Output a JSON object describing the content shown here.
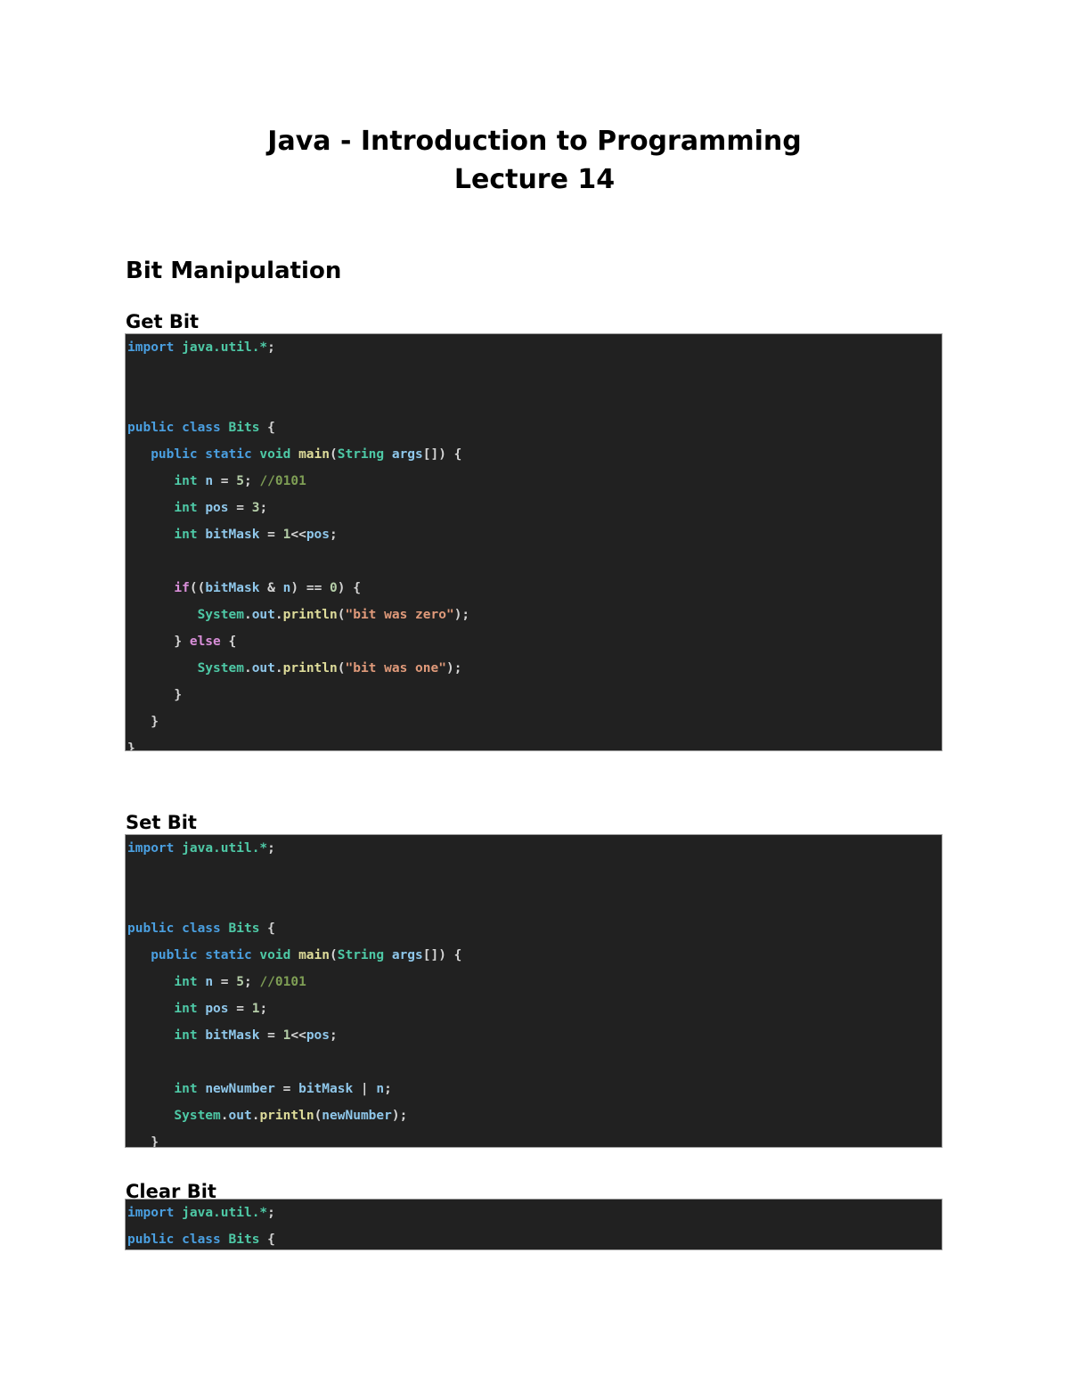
{
  "document": {
    "title_lines": [
      "Java - Introduction to Programming",
      "Lecture 14"
    ],
    "section_heading": "Bit Manipulation",
    "subheadings": {
      "get_bit": "Get Bit",
      "set_bit": "Set Bit",
      "clear_bit": "Clear Bit"
    }
  },
  "code_blocks": {
    "get_bit": {
      "language": "java",
      "lines": [
        "import java.util.*;",
        "",
        "",
        "public class Bits {",
        "    public static void main(String args[]) {",
        "        int n = 5; //0101",
        "        int pos = 3;",
        "        int bitMask = 1<<pos;",
        "",
        "        if((bitMask & n) == 0) {",
        "            System.out.println(\"bit was zero\");",
        "        } else {",
        "            System.out.println(\"bit was one\");",
        "        }",
        "    }",
        "}"
      ]
    },
    "set_bit": {
      "language": "java",
      "lines": [
        "import java.util.*;",
        "",
        "",
        "public class Bits {",
        "    public static void main(String args[]) {",
        "        int n = 5; //0101",
        "        int pos = 1;",
        "        int bitMask = 1<<pos;",
        "",
        "        int newNumber = bitMask | n;",
        "        System.out.println(newNumber);",
        "    }",
        "}"
      ]
    },
    "clear_bit": {
      "language": "java",
      "lines": [
        "import java.util.*;",
        "public class Bits {"
      ]
    }
  },
  "theme": {
    "page_background": "#ffffff",
    "code_background": "#212121",
    "code_border": "#9e9e9e",
    "text": "#000000",
    "keyword": "#4a9fe0",
    "control": "#d98fd9",
    "type": "#4ec9a6",
    "identifier": "#8fc7ea",
    "function": "#dedc9a",
    "number": "#b5cea8",
    "string": "#e09a7a",
    "comment": "#7f9f55",
    "punctuation": "#d4d4d4"
  }
}
